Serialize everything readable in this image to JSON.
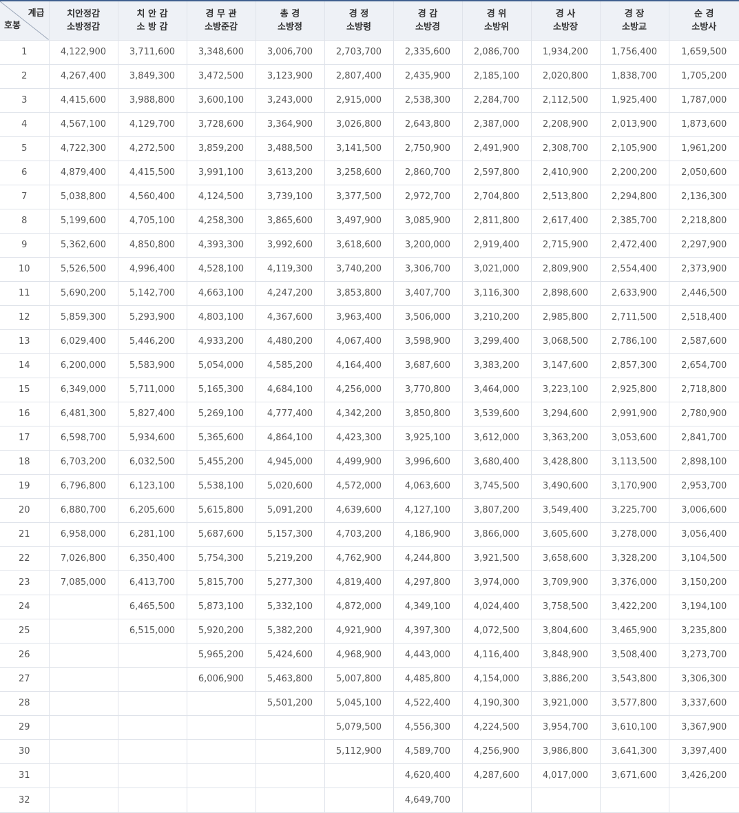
{
  "header": {
    "corner_top": "계급",
    "corner_bottom": "호봉",
    "columns": [
      {
        "line1": "치안정감",
        "line2": "소방정감"
      },
      {
        "line1": "치 안 감",
        "line2": "소 방 감"
      },
      {
        "line1": "경 무 관",
        "line2": "소방준감"
      },
      {
        "line1": "총 경",
        "line2": "소방정"
      },
      {
        "line1": "경 정",
        "line2": "소방령"
      },
      {
        "line1": "경 감",
        "line2": "소방경"
      },
      {
        "line1": "경 위",
        "line2": "소방위"
      },
      {
        "line1": "경 사",
        "line2": "소방장"
      },
      {
        "line1": "경 장",
        "line2": "소방교"
      },
      {
        "line1": "순 경",
        "line2": "소방사"
      }
    ]
  },
  "rows": [
    [
      "1",
      "4,122,900",
      "3,711,600",
      "3,348,600",
      "3,006,700",
      "2,703,700",
      "2,335,600",
      "2,086,700",
      "1,934,200",
      "1,756,400",
      "1,659,500"
    ],
    [
      "2",
      "4,267,400",
      "3,849,300",
      "3,472,500",
      "3,123,900",
      "2,807,400",
      "2,435,900",
      "2,185,100",
      "2,020,800",
      "1,838,700",
      "1,705,200"
    ],
    [
      "3",
      "4,415,600",
      "3,988,800",
      "3,600,100",
      "3,243,000",
      "2,915,000",
      "2,538,300",
      "2,284,700",
      "2,112,500",
      "1,925,400",
      "1,787,000"
    ],
    [
      "4",
      "4,567,100",
      "4,129,700",
      "3,728,600",
      "3,364,900",
      "3,026,800",
      "2,643,800",
      "2,387,000",
      "2,208,900",
      "2,013,900",
      "1,873,600"
    ],
    [
      "5",
      "4,722,300",
      "4,272,500",
      "3,859,200",
      "3,488,500",
      "3,141,500",
      "2,750,900",
      "2,491,900",
      "2,308,700",
      "2,105,900",
      "1,961,200"
    ],
    [
      "6",
      "4,879,400",
      "4,415,500",
      "3,991,100",
      "3,613,200",
      "3,258,600",
      "2,860,700",
      "2,597,800",
      "2,410,900",
      "2,200,200",
      "2,050,600"
    ],
    [
      "7",
      "5,038,800",
      "4,560,400",
      "4,124,500",
      "3,739,100",
      "3,377,500",
      "2,972,700",
      "2,704,800",
      "2,513,800",
      "2,294,800",
      "2,136,300"
    ],
    [
      "8",
      "5,199,600",
      "4,705,100",
      "4,258,300",
      "3,865,600",
      "3,497,900",
      "3,085,900",
      "2,811,800",
      "2,617,400",
      "2,385,700",
      "2,218,800"
    ],
    [
      "9",
      "5,362,600",
      "4,850,800",
      "4,393,300",
      "3,992,600",
      "3,618,600",
      "3,200,000",
      "2,919,400",
      "2,715,900",
      "2,472,400",
      "2,297,900"
    ],
    [
      "10",
      "5,526,500",
      "4,996,400",
      "4,528,100",
      "4,119,300",
      "3,740,200",
      "3,306,700",
      "3,021,000",
      "2,809,900",
      "2,554,400",
      "2,373,900"
    ],
    [
      "11",
      "5,690,200",
      "5,142,700",
      "4,663,100",
      "4,247,200",
      "3,853,800",
      "3,407,700",
      "3,116,300",
      "2,898,600",
      "2,633,900",
      "2,446,500"
    ],
    [
      "12",
      "5,859,300",
      "5,293,900",
      "4,803,100",
      "4,367,600",
      "3,963,400",
      "3,506,000",
      "3,210,200",
      "2,985,800",
      "2,711,500",
      "2,518,400"
    ],
    [
      "13",
      "6,029,400",
      "5,446,200",
      "4,933,200",
      "4,480,200",
      "4,067,400",
      "3,598,900",
      "3,299,400",
      "3,068,500",
      "2,786,100",
      "2,587,600"
    ],
    [
      "14",
      "6,200,000",
      "5,583,900",
      "5,054,000",
      "4,585,200",
      "4,164,400",
      "3,687,600",
      "3,383,200",
      "3,147,600",
      "2,857,300",
      "2,654,700"
    ],
    [
      "15",
      "6,349,000",
      "5,711,000",
      "5,165,300",
      "4,684,100",
      "4,256,000",
      "3,770,800",
      "3,464,000",
      "3,223,100",
      "2,925,800",
      "2,718,800"
    ],
    [
      "16",
      "6,481,300",
      "5,827,400",
      "5,269,100",
      "4,777,400",
      "4,342,200",
      "3,850,800",
      "3,539,600",
      "3,294,600",
      "2,991,900",
      "2,780,900"
    ],
    [
      "17",
      "6,598,700",
      "5,934,600",
      "5,365,600",
      "4,864,100",
      "4,423,300",
      "3,925,100",
      "3,612,000",
      "3,363,200",
      "3,053,600",
      "2,841,700"
    ],
    [
      "18",
      "6,703,200",
      "6,032,500",
      "5,455,200",
      "4,945,000",
      "4,499,900",
      "3,996,600",
      "3,680,400",
      "3,428,800",
      "3,113,500",
      "2,898,100"
    ],
    [
      "19",
      "6,796,800",
      "6,123,100",
      "5,538,100",
      "5,020,600",
      "4,572,000",
      "4,063,600",
      "3,745,500",
      "3,490,600",
      "3,170,900",
      "2,953,700"
    ],
    [
      "20",
      "6,880,700",
      "6,205,600",
      "5,615,800",
      "5,091,200",
      "4,639,600",
      "4,127,100",
      "3,807,200",
      "3,549,400",
      "3,225,700",
      "3,006,600"
    ],
    [
      "21",
      "6,958,000",
      "6,281,100",
      "5,687,600",
      "5,157,300",
      "4,703,200",
      "4,186,900",
      "3,866,000",
      "3,605,600",
      "3,278,000",
      "3,056,400"
    ],
    [
      "22",
      "7,026,800",
      "6,350,400",
      "5,754,300",
      "5,219,200",
      "4,762,900",
      "4,244,800",
      "3,921,500",
      "3,658,600",
      "3,328,200",
      "3,104,500"
    ],
    [
      "23",
      "7,085,000",
      "6,413,700",
      "5,815,700",
      "5,277,300",
      "4,819,400",
      "4,297,800",
      "3,974,000",
      "3,709,900",
      "3,376,000",
      "3,150,200"
    ],
    [
      "24",
      "",
      "6,465,500",
      "5,873,100",
      "5,332,100",
      "4,872,000",
      "4,349,100",
      "4,024,400",
      "3,758,500",
      "3,422,200",
      "3,194,100"
    ],
    [
      "25",
      "",
      "6,515,000",
      "5,920,200",
      "5,382,200",
      "4,921,900",
      "4,397,300",
      "4,072,500",
      "3,804,600",
      "3,465,900",
      "3,235,800"
    ],
    [
      "26",
      "",
      "",
      "5,965,200",
      "5,424,600",
      "4,968,900",
      "4,443,000",
      "4,116,400",
      "3,848,900",
      "3,508,400",
      "3,273,700"
    ],
    [
      "27",
      "",
      "",
      "6,006,900",
      "5,463,800",
      "5,007,800",
      "4,485,800",
      "4,154,000",
      "3,886,200",
      "3,543,800",
      "3,306,300"
    ],
    [
      "28",
      "",
      "",
      "",
      "5,501,200",
      "5,045,100",
      "4,522,400",
      "4,190,300",
      "3,921,000",
      "3,577,800",
      "3,337,600"
    ],
    [
      "29",
      "",
      "",
      "",
      "",
      "5,079,500",
      "4,556,300",
      "4,224,500",
      "3,954,700",
      "3,610,100",
      "3,367,900"
    ],
    [
      "30",
      "",
      "",
      "",
      "",
      "5,112,900",
      "4,589,700",
      "4,256,900",
      "3,986,800",
      "3,641,300",
      "3,397,400"
    ],
    [
      "31",
      "",
      "",
      "",
      "",
      "",
      "4,620,400",
      "4,287,600",
      "4,017,000",
      "3,671,600",
      "3,426,200"
    ],
    [
      "32",
      "",
      "",
      "",
      "",
      "",
      "4,649,700",
      "",
      "",
      "",
      ""
    ]
  ]
}
